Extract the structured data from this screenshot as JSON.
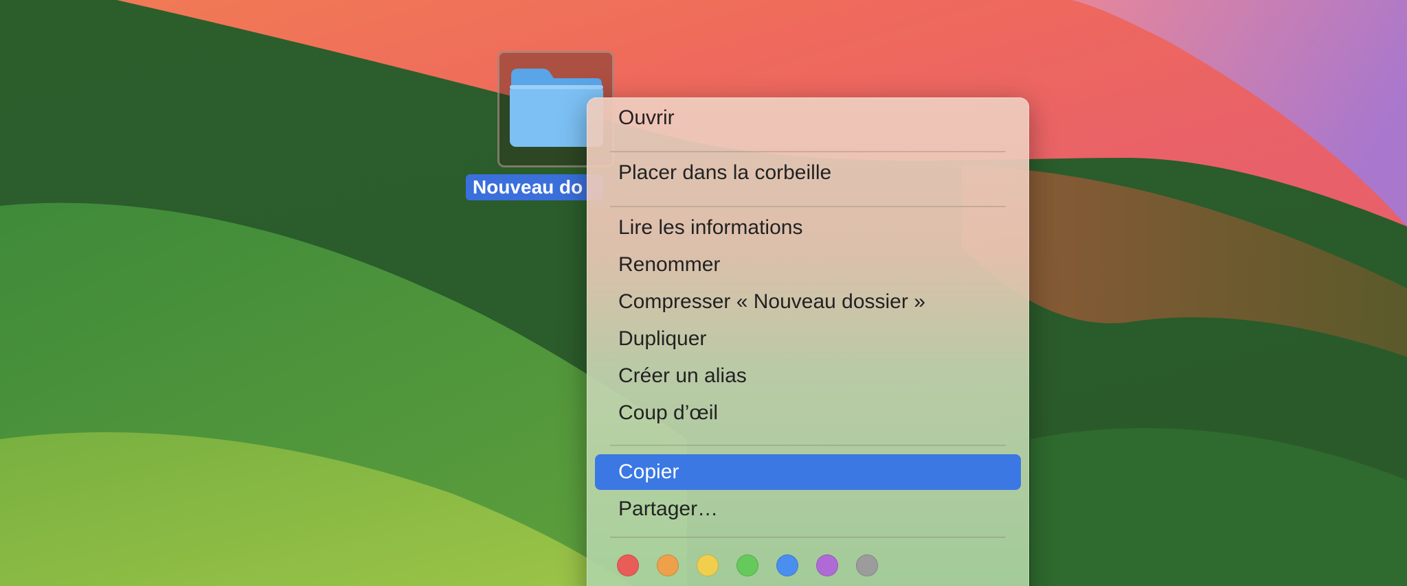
{
  "desktop": {
    "folder": {
      "label": "Nouveau do",
      "icon": "folder-icon",
      "folder_color": "#6fb6f0"
    }
  },
  "context_menu": {
    "items": [
      {
        "label": "Ouvrir"
      },
      {
        "label": "Placer dans la corbeille"
      },
      {
        "label": "Lire les informations"
      },
      {
        "label": "Renommer"
      },
      {
        "label": "Compresser « Nouveau dossier »"
      },
      {
        "label": "Dupliquer"
      },
      {
        "label": "Créer un alias"
      },
      {
        "label": "Coup d’œil"
      },
      {
        "label": "Copier",
        "selected": true
      },
      {
        "label": "Partager…"
      }
    ],
    "tags": [
      {
        "name": "red",
        "color": "#ea5c58"
      },
      {
        "name": "orange",
        "color": "#eea04a"
      },
      {
        "name": "yellow",
        "color": "#f0cf4e"
      },
      {
        "name": "green",
        "color": "#66c95c"
      },
      {
        "name": "blue",
        "color": "#4a8ef0"
      },
      {
        "name": "purple",
        "color": "#b06ad6"
      },
      {
        "name": "gray",
        "color": "#9c9c9c"
      }
    ],
    "selection_color": "#3b78e3"
  }
}
